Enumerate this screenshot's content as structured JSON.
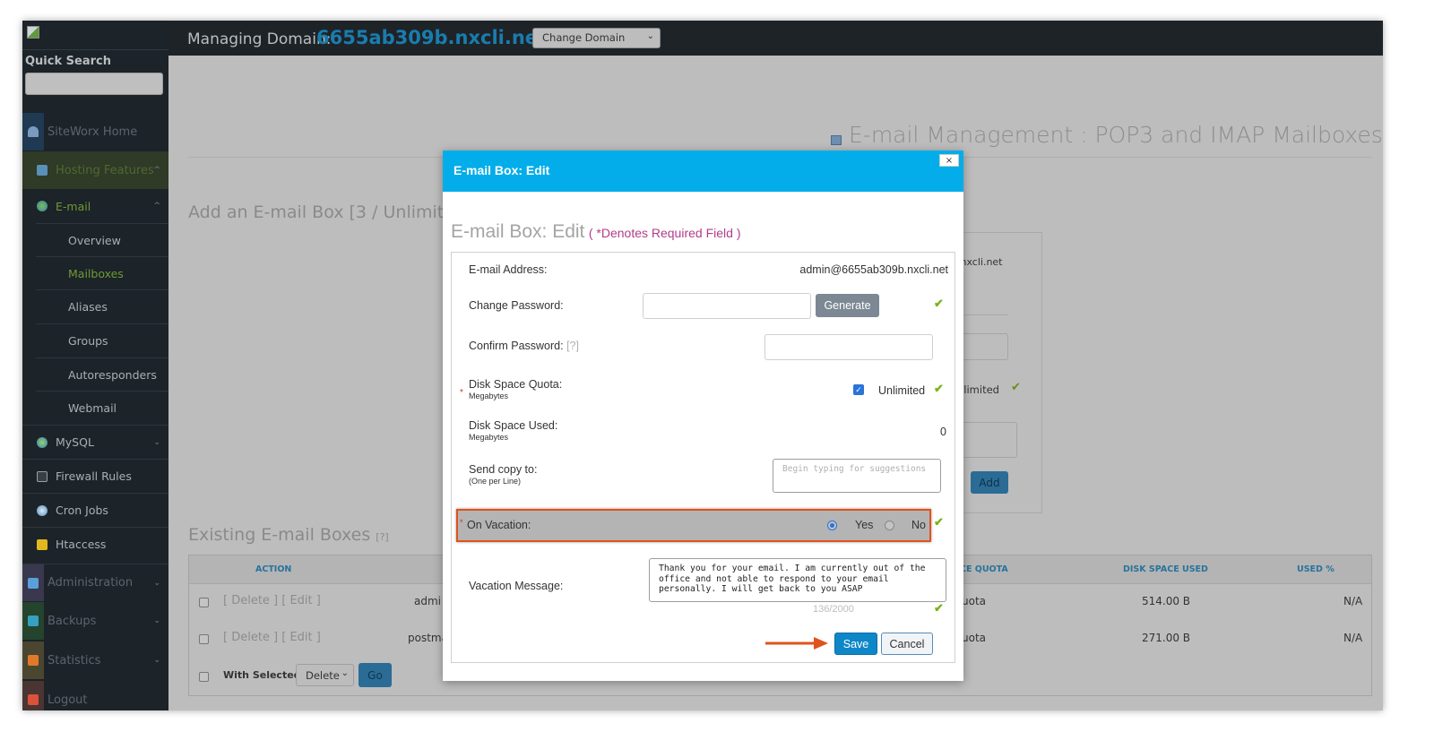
{
  "header": {
    "managing_label": "Managing Domain:",
    "domain": "6655ab309b.nxcli.net",
    "change_domain_select": "Change Domain"
  },
  "sidebar": {
    "quick_search_label": "Quick Search",
    "quick_search_value": "",
    "items": [
      {
        "label": "SiteWorx Home",
        "icon": "home-icon"
      },
      {
        "label": "Hosting Features",
        "icon": "monitor-icon",
        "expanded": true
      },
      {
        "label": "E-mail",
        "icon": "email-globe-icon",
        "expanded": true
      },
      {
        "label": "Overview"
      },
      {
        "label": "Mailboxes",
        "active": true
      },
      {
        "label": "Aliases"
      },
      {
        "label": "Groups"
      },
      {
        "label": "Autoresponders"
      },
      {
        "label": "Webmail"
      },
      {
        "label": "MySQL",
        "icon": "database-icon"
      },
      {
        "label": "Firewall Rules",
        "icon": "terminal-icon"
      },
      {
        "label": "Cron Jobs",
        "icon": "clock-icon"
      },
      {
        "label": "Htaccess",
        "icon": "folder-icon"
      },
      {
        "label": "Administration",
        "icon": "tools-icon"
      },
      {
        "label": "Backups",
        "icon": "backup-icon"
      },
      {
        "label": "Statistics",
        "icon": "chart-icon"
      },
      {
        "label": "Logout",
        "icon": "logout-icon"
      }
    ]
  },
  "page": {
    "title": "E-mail Management : POP3 and IMAP Mailboxes",
    "add_section_title": "Add an E-mail Box [3 / Unlimit",
    "add_form": {
      "domain_suffix": ".nxcli.net",
      "unlimited_label": "nlimited",
      "add_button": "Add"
    },
    "existing_title": "Existing E-mail Boxes",
    "existing_help": "[?]",
    "table": {
      "headers": [
        "ACTION",
        "CE QUOTA",
        "DISK SPACE USED",
        "USED %"
      ],
      "rows": [
        {
          "actions": "[ Delete ] [ Edit ]",
          "name": "admi",
          "quota": "uota",
          "used": "514.00 B",
          "pct": "N/A"
        },
        {
          "actions": "[ Delete ] [ Edit ]",
          "name": "postma",
          "quota": "uota",
          "used": "271.00 B",
          "pct": "N/A"
        }
      ],
      "with_selected_label": "With Selected:",
      "with_selected_value": "Delete",
      "go_button": "Go"
    }
  },
  "modal": {
    "title": "E-mail Box: Edit",
    "close_label": "×",
    "form_title": "E-mail Box: Edit",
    "required_note": "( *Denotes Required Field )",
    "fields": {
      "email_label": "E-mail Address:",
      "email_value": "admin@6655ab309b.nxcli.net",
      "change_password_label": "Change Password:",
      "change_password_value": "",
      "generate_button": "Generate",
      "confirm_password_label": "Confirm Password:",
      "confirm_password_help": "[?]",
      "confirm_password_value": "",
      "quota_label": "Disk Space Quota:",
      "quota_sub": "Megabytes",
      "quota_unlimited_checked": true,
      "quota_unlimited_label": "Unlimited",
      "used_label": "Disk Space Used:",
      "used_sub": "Megabytes",
      "used_value": "0",
      "copy_label": "Send copy to:",
      "copy_sub": "(One per Line)",
      "copy_placeholder": "Begin typing for suggestions",
      "vacation_label": "On Vacation:",
      "vacation_yes": "Yes",
      "vacation_no": "No",
      "vacation_selected": "Yes",
      "message_label": "Vacation Message:",
      "message_value": "Thank you for your email. I am currently out of the office and not able to respond to your email personally. I will get back to you ASAP",
      "message_counter": "136/2000"
    },
    "save_button": "Save",
    "cancel_button": "Cancel"
  },
  "colors": {
    "modal_header": "#02adea",
    "domain_link": "#1a7cad",
    "highlight": "#e0531b",
    "active_nav": "#6f9a33",
    "required_note": "#b23c8a"
  }
}
